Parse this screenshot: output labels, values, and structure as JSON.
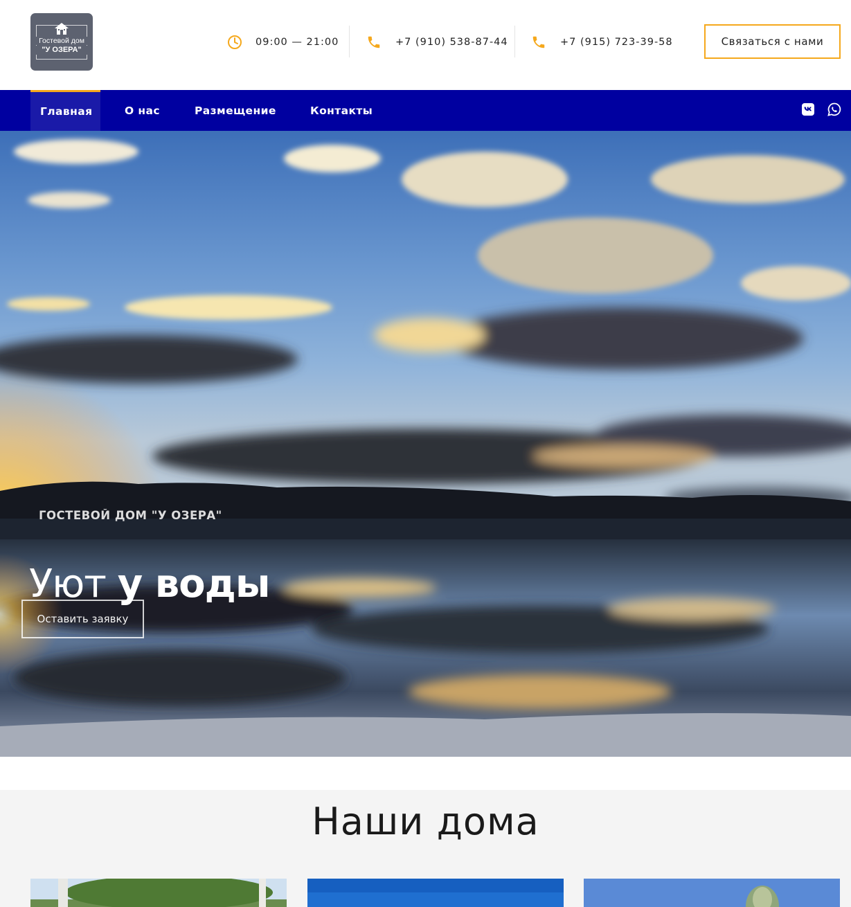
{
  "logo": {
    "line1": "Гостевой дом",
    "line2": "\"У ОЗЕРА\""
  },
  "header": {
    "hours": "09:00 — 21:00",
    "phone1": "+7 (910) 538-87-44",
    "phone2": "+7 (915) 723-39-58",
    "contact_button": "Связаться с нами"
  },
  "nav": {
    "items": [
      {
        "label": "Главная",
        "active": true
      },
      {
        "label": "О нас",
        "active": false
      },
      {
        "label": "Размещение",
        "active": false
      },
      {
        "label": "Контакты",
        "active": false
      }
    ],
    "social": [
      "vk-icon",
      "whatsapp-icon"
    ]
  },
  "hero": {
    "kicker": "ГОСТЕВОЙ ДОМ \"У ОЗЕРА\"",
    "title_light": "Уют ",
    "title_bold": "у воды",
    "button": "Оставить заявку"
  },
  "houses": {
    "title": "Наши дома"
  },
  "colors": {
    "accent": "#f5a81c",
    "nav_bg": "#0000a0",
    "logo_bg": "#5d6270"
  }
}
